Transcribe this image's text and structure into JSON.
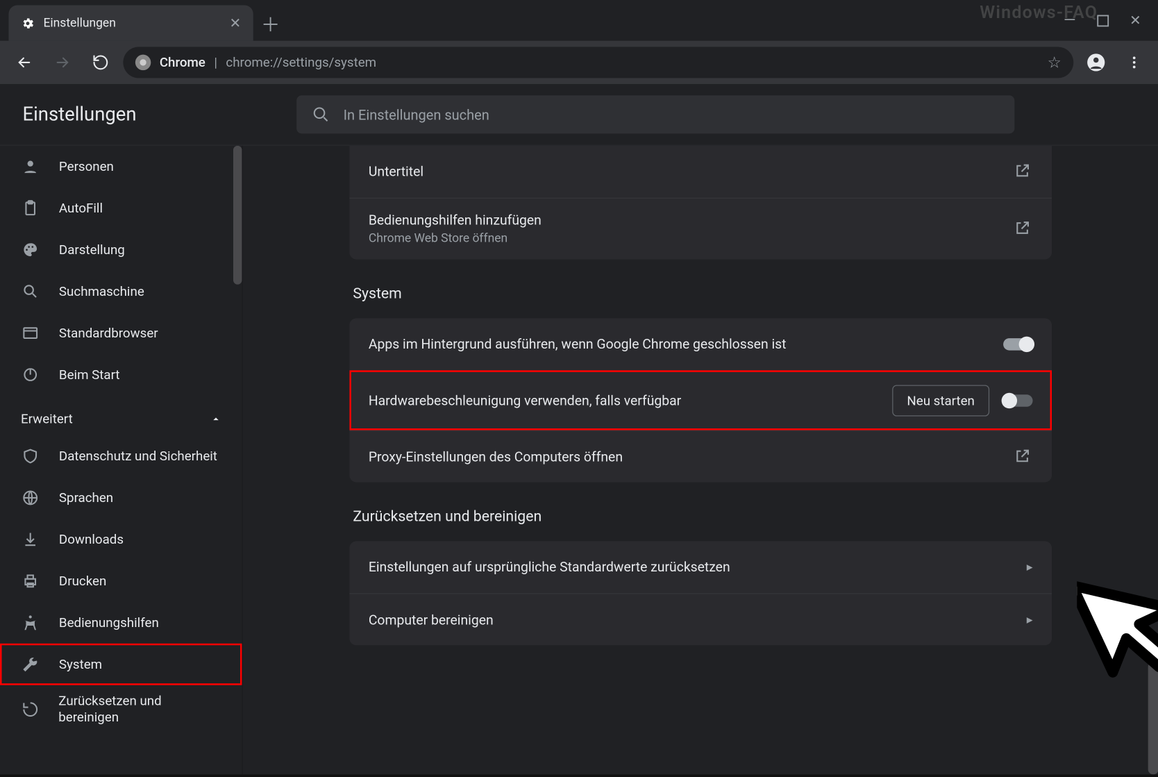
{
  "watermark": "Windows-FAQ",
  "tab": {
    "title": "Einstellungen"
  },
  "omnibox": {
    "label": "Chrome",
    "url": "chrome://settings/system"
  },
  "settings": {
    "title": "Einstellungen",
    "search_placeholder": "In Einstellungen suchen"
  },
  "sidebar": {
    "items": [
      {
        "icon": "person",
        "label": "Personen"
      },
      {
        "icon": "clipboard",
        "label": "AutoFill"
      },
      {
        "icon": "palette",
        "label": "Darstellung"
      },
      {
        "icon": "search",
        "label": "Suchmaschine"
      },
      {
        "icon": "browser",
        "label": "Standardbrowser"
      },
      {
        "icon": "power",
        "label": "Beim Start"
      }
    ],
    "section": "Erweitert",
    "adv": [
      {
        "icon": "shield",
        "label": "Datenschutz und Sicherheit"
      },
      {
        "icon": "globe",
        "label": "Sprachen"
      },
      {
        "icon": "download",
        "label": "Downloads"
      },
      {
        "icon": "printer",
        "label": "Drucken"
      },
      {
        "icon": "accessibility",
        "label": "Bedienungshilfen"
      },
      {
        "icon": "wrench",
        "label": "System"
      },
      {
        "icon": "restore",
        "label": "Zurücksetzen und bereinigen"
      }
    ]
  },
  "main": {
    "top_card": [
      {
        "title": "Untertitel"
      },
      {
        "title": "Bedienungshilfen hinzufügen",
        "sub": "Chrome Web Store öffnen"
      }
    ],
    "system_head": "System",
    "system_card": [
      {
        "title": "Apps im Hintergrund ausführen, wenn Google Chrome geschlossen ist",
        "toggle": "on"
      },
      {
        "title": "Hardwarebeschleunigung verwenden, falls verfügbar",
        "button": "Neu starten",
        "toggle": "off"
      },
      {
        "title": "Proxy-Einstellungen des Computers öffnen",
        "ext": true
      }
    ],
    "reset_head": "Zurücksetzen und bereinigen",
    "reset_card": [
      {
        "title": "Einstellungen auf ursprüngliche Standardwerte zurücksetzen"
      },
      {
        "title": "Computer bereinigen"
      }
    ]
  }
}
